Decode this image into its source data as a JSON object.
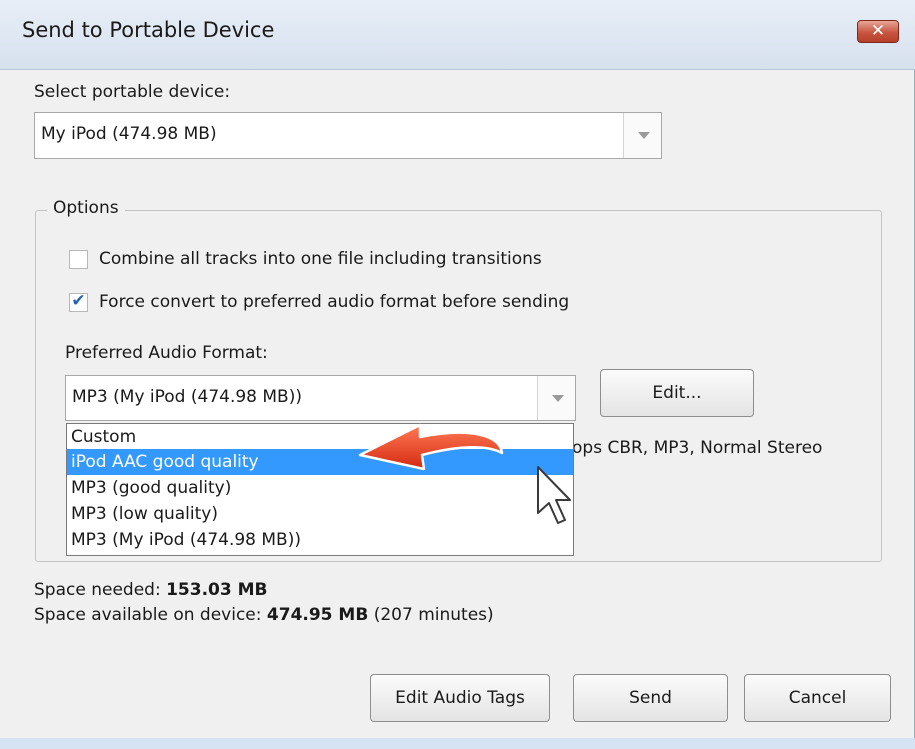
{
  "window": {
    "title": "Send to Portable Device",
    "close_glyph": "✕"
  },
  "device": {
    "label": "Select portable device:",
    "selected": "My iPod (474.98 MB)"
  },
  "options": {
    "legend": "Options",
    "combine_label": "Combine all tracks into one file including transitions",
    "combine_checked": false,
    "force_label": "Force convert to preferred audio format before sending",
    "force_checked": true,
    "check_glyph": "✔",
    "format_label": "Preferred Audio Format:",
    "format_selected": "MP3 (My iPod (474.98 MB))",
    "edit_button": "Edit...",
    "format_info": "ops CBR, MP3, Normal Stereo",
    "format_options": [
      "Custom",
      "iPod AAC good quality",
      "MP3 (good quality)",
      "MP3 (low quality)",
      "MP3 (My iPod (474.98 MB))"
    ],
    "format_highlighted_index": 1
  },
  "space": {
    "needed_label": "Space needed:",
    "needed_value": "153.03 MB",
    "available_label": "Space available on device:",
    "available_value": "474.95 MB",
    "available_minutes": "(207 minutes)"
  },
  "buttons": {
    "edit_tags": "Edit Audio Tags",
    "send": "Send",
    "cancel": "Cancel"
  },
  "colors": {
    "highlight": "#3399ff",
    "annotation_arrow": "#e8402a"
  },
  "icons": {
    "annotation": "red-arrow-icon",
    "cursor": "mouse-cursor-icon"
  }
}
